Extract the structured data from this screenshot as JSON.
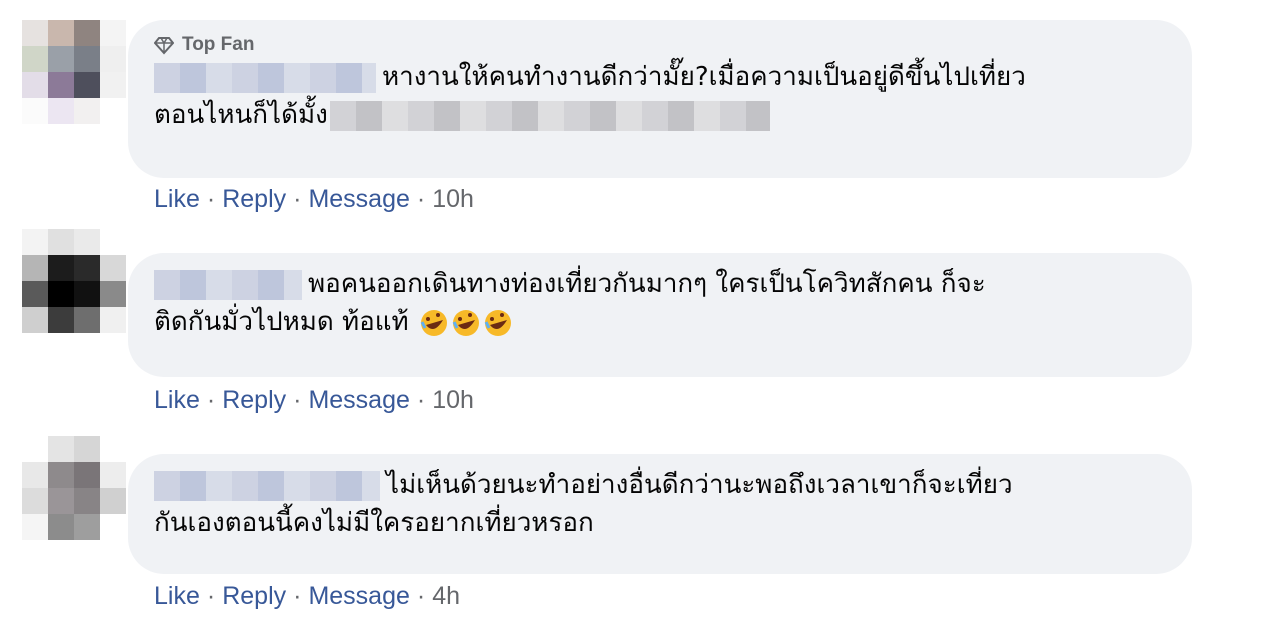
{
  "comments": [
    {
      "badge": "Top Fan",
      "text_line1": "หางานให้คนทำงานดีกว่ามั๊ย?เมื่อความเป็นอยู่ดีขึ้นไปเที่ยว",
      "text_line2": "ตอนไหนก็ได้มั้ง",
      "actions": {
        "like": "Like",
        "reply": "Reply",
        "message": "Message",
        "time": "10h"
      },
      "separator": "·"
    },
    {
      "text_line1": "พอคนออกเดินทางท่องเที่ยวกันมากๆ ใครเป็นโควิทสักคน ก็จะ",
      "text_line2": "ติดกันมั่วไปหมด ท้อแท้",
      "emoji": [
        "rolling-on-floor-laughing-emoji",
        "rolling-on-floor-laughing-emoji",
        "rolling-on-floor-laughing-emoji"
      ],
      "actions": {
        "like": "Like",
        "reply": "Reply",
        "message": "Message",
        "time": "10h"
      },
      "separator": "·"
    },
    {
      "text_line1": "ไม่เห็นด้วยนะทำอย่างอื่นดีกว่านะพอถึงเวลาเขาก็จะเที่ยว",
      "text_line2": "กันเองตอนนี้คงไม่มีใครอยากเที่ยวหรอก",
      "actions": {
        "like": "Like",
        "reply": "Reply",
        "message": "Message",
        "time": "4h"
      },
      "separator": "·"
    }
  ],
  "colors": {
    "bubble": "#f0f2f5",
    "action_link": "#385898",
    "meta": "#65676b",
    "text": "#050505"
  }
}
